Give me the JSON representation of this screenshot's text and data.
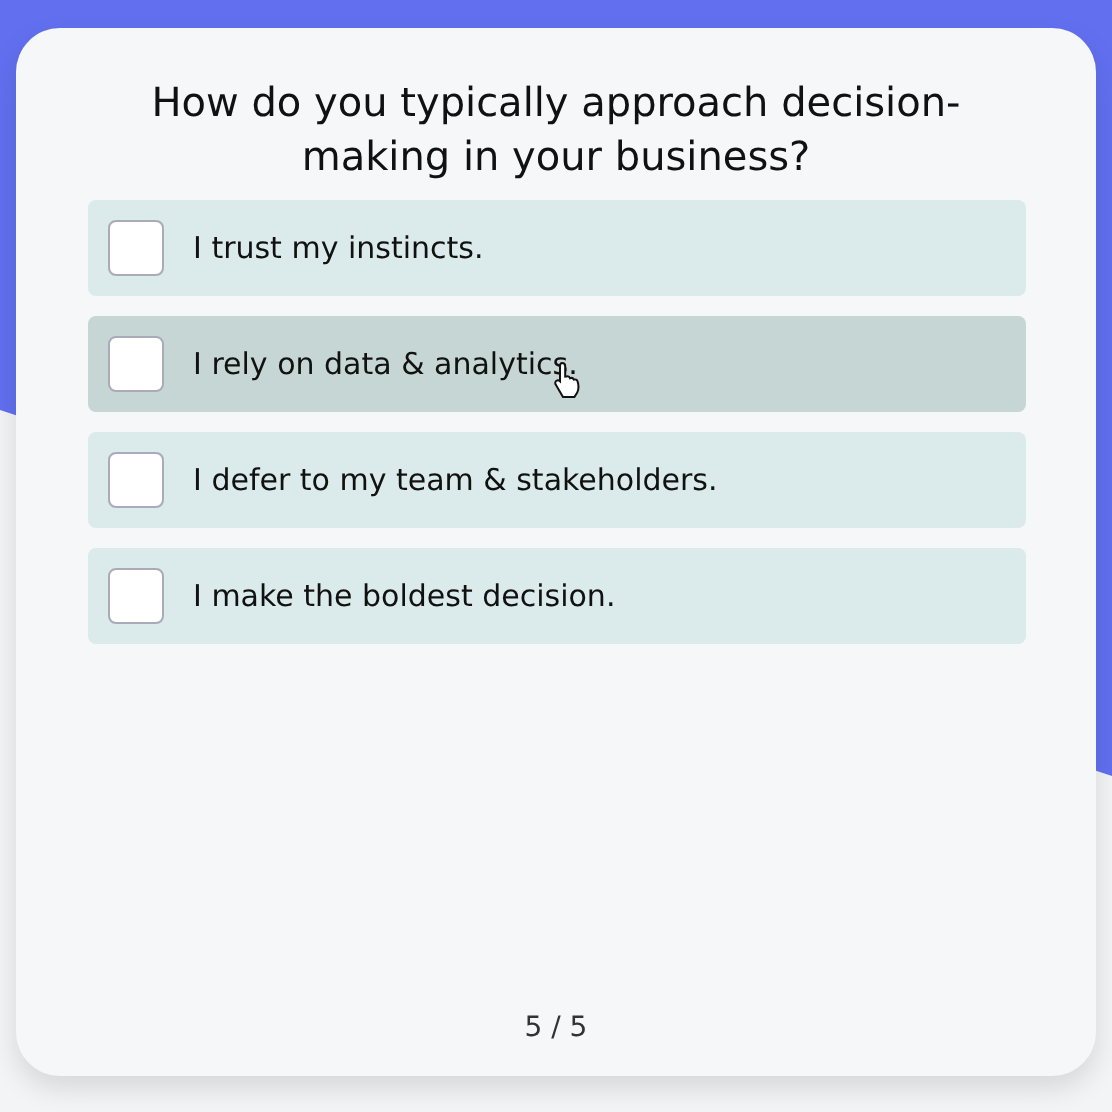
{
  "question": "How do you typically approach decision-making in your business?",
  "options": [
    {
      "label": "I trust my instincts.",
      "checked": false,
      "hovered": false
    },
    {
      "label": "I rely on data & analytics.",
      "checked": false,
      "hovered": true
    },
    {
      "label": "I defer to my team & stakeholders.",
      "checked": false,
      "hovered": false
    },
    {
      "label": "I make the boldest decision.",
      "checked": false,
      "hovered": false
    }
  ],
  "progress": "5 / 5"
}
